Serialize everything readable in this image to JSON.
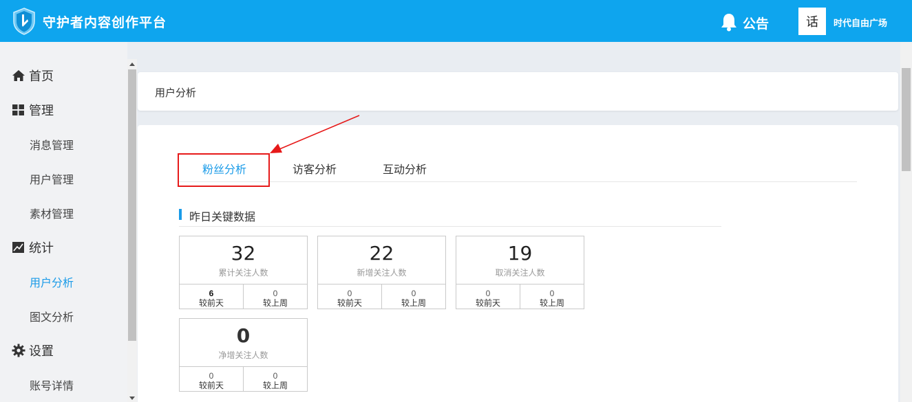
{
  "header": {
    "app_title": "守护者内容创作平台",
    "notice": "公告",
    "avatar_text": "话",
    "account_name": "时代自由广场"
  },
  "sidebar": {
    "items": [
      {
        "label": "首页"
      },
      {
        "label": "管理"
      },
      {
        "label": "消息管理"
      },
      {
        "label": "用户管理"
      },
      {
        "label": "素材管理"
      },
      {
        "label": "统计"
      },
      {
        "label": "用户分析"
      },
      {
        "label": "图文分析"
      },
      {
        "label": "设置"
      },
      {
        "label": "账号详情"
      }
    ],
    "active_item": "用户分析"
  },
  "breadcrumb": "用户分析",
  "tabs": [
    {
      "label": "粉丝分析",
      "active": true
    },
    {
      "label": "访客分析",
      "active": false
    },
    {
      "label": "互动分析",
      "active": false
    }
  ],
  "section_title": "昨日关键数据",
  "stats": [
    {
      "value": "32",
      "label": "累计关注人数",
      "day_value": "6",
      "day_label": "较前天",
      "week_value": "0",
      "week_label": "较上周"
    },
    {
      "value": "22",
      "label": "新增关注人数",
      "day_value": "0",
      "day_label": "较前天",
      "week_value": "0",
      "week_label": "较上周"
    },
    {
      "value": "19",
      "label": "取消关注人数",
      "day_value": "0",
      "day_label": "较前天",
      "week_value": "0",
      "week_label": "较上周"
    },
    {
      "value": "0",
      "label": "净增关注人数",
      "day_value": "0",
      "day_label": "较前天",
      "week_value": "0",
      "week_label": "较上周"
    }
  ],
  "colors": {
    "header_bg": "#0ea5ee",
    "accent": "#1a9be8",
    "annotation": "#e61919"
  }
}
